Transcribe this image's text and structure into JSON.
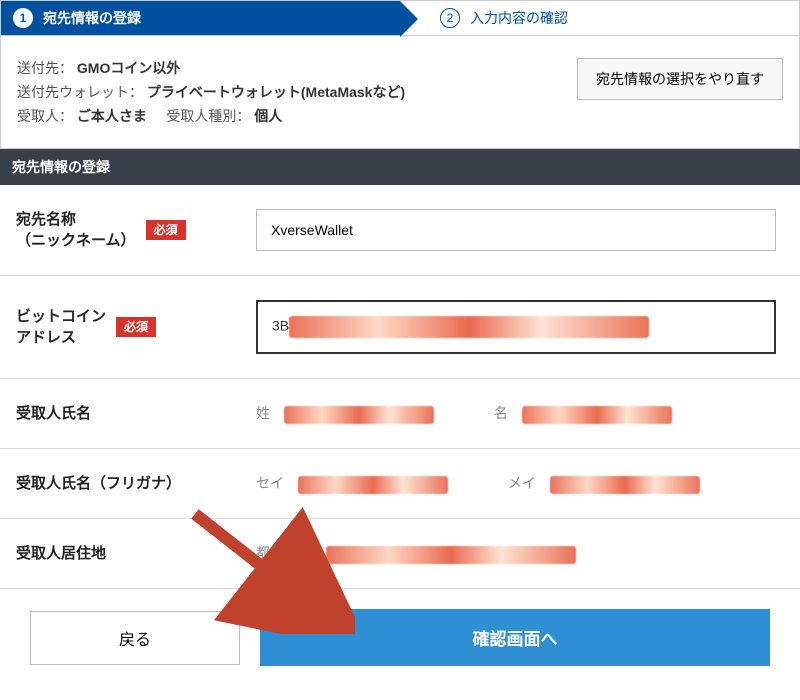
{
  "steps": {
    "step1": {
      "num": "1",
      "label": "宛先情報の登録"
    },
    "step2": {
      "num": "2",
      "label": "入力内容の確認"
    }
  },
  "summary": {
    "dest_key": "送付先：",
    "dest_val": "GMOコイン以外",
    "wallet_key": "送付先ウォレット：",
    "wallet_val": "プライベートウォレット(MetaMaskなど)",
    "recipient_key": "受取人：",
    "recipient_val": "ご本人さま",
    "recipient_type_key": "受取人種別：",
    "recipient_type_val": "個人",
    "redo_btn": "宛先情報の選択をやり直す"
  },
  "section_title": "宛先情報の登録",
  "form": {
    "required_badge": "必須",
    "nickname": {
      "label": "宛先名称\n（ニックネーム）",
      "value": "XverseWallet"
    },
    "btc_address": {
      "label": "ビットコイン\nアドレス",
      "prefix": "3B"
    },
    "recipient_name": {
      "label": "受取人氏名",
      "last_lbl": "姓",
      "first_lbl": "名"
    },
    "recipient_kana": {
      "label": "受取人氏名（フリガナ）",
      "last_lbl": "セイ",
      "first_lbl": "メイ"
    },
    "residence": {
      "label": "受取人居住地",
      "city_lbl": "都市・州"
    }
  },
  "buttons": {
    "back": "戻る",
    "next": "確認画面へ"
  },
  "colors": {
    "primary": "#0050a0",
    "accent_blue": "#2f8fd5",
    "required_red": "#d9342b",
    "header_dark": "#3a4049"
  }
}
